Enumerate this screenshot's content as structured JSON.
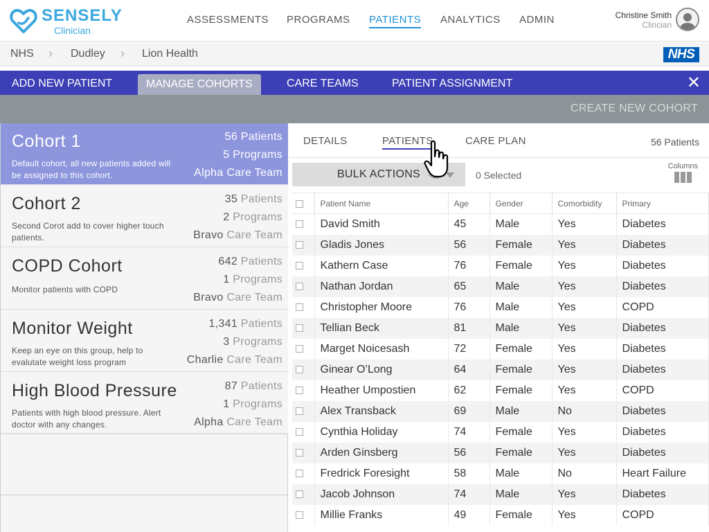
{
  "header": {
    "brand": "SENSELY",
    "brand_sub": "Clinician",
    "nav": [
      {
        "label": "ASSESSMENTS",
        "active": false
      },
      {
        "label": "PROGRAMS",
        "active": false
      },
      {
        "label": "PATIENTS",
        "active": true
      },
      {
        "label": "ANALYTICS",
        "active": false
      },
      {
        "label": "ADMIN",
        "active": false
      }
    ],
    "user_name": "Christine Smith",
    "user_role": "Clincian"
  },
  "breadcrumb": [
    "NHS",
    "Dudley",
    "Lion Health"
  ],
  "nhs_logo": "NHS",
  "tabs": [
    {
      "label": "ADD NEW PATIENT",
      "active": false
    },
    {
      "label": "MANAGE COHORTS",
      "active": true
    },
    {
      "label": "CARE TEAMS",
      "active": false
    },
    {
      "label": "PATIENT ASSIGNMENT",
      "active": false
    }
  ],
  "close_label": "✕",
  "create_label": "CREATE NEW COHORT",
  "cohorts": [
    {
      "title": "Cohort 1",
      "desc": "Default cohort, all new patients added will be assigned to this cohort.",
      "patients_num": "56",
      "patients_word": "Patients",
      "programs_num": "5",
      "programs_word": "Programs",
      "team_name": "Alpha",
      "team_word": "Care Team",
      "active": true
    },
    {
      "title": "Cohort 2",
      "desc": "Second Corot add to cover higher touch patients.",
      "patients_num": "35",
      "patients_word": "Patients",
      "programs_num": "2",
      "programs_word": "Programs",
      "team_name": "Bravo",
      "team_word": "Care Team",
      "active": false
    },
    {
      "title": "COPD Cohort",
      "desc": "Monitor patients with COPD",
      "patients_num": "642",
      "patients_word": "Patients",
      "programs_num": "1",
      "programs_word": "Programs",
      "team_name": "Bravo",
      "team_word": "Care Team",
      "active": false
    },
    {
      "title": "Monitor Weight",
      "desc": "Keep an eye on this group, help to evalutate weight loss program",
      "patients_num": "1,341",
      "patients_word": "Patients",
      "programs_num": "3",
      "programs_word": "Programs",
      "team_name": "Charlie",
      "team_word": "Care Team",
      "active": false
    },
    {
      "title": "High Blood Pressure",
      "desc": "Patients with high blood pressure.  Alert doctor with any changes.",
      "patients_num": "87",
      "patients_word": "Patients",
      "programs_num": "1",
      "programs_word": "Programs",
      "team_name": "Alpha",
      "team_word": "Care Team",
      "active": false
    }
  ],
  "detail": {
    "tabs": [
      {
        "label": "DETAILS",
        "active": false
      },
      {
        "label": "PATIENTS",
        "active": true
      },
      {
        "label": "CARE PLAN",
        "active": false
      }
    ],
    "patient_count": "56 Patients",
    "bulk_label": "BULK ACTIONS",
    "selected_label": "0 Selected",
    "columns_label": "Columns",
    "columns": [
      "Patient Name",
      "Age",
      "Gender",
      "Comorbidity",
      "Primary"
    ],
    "rows": [
      [
        "David Smith",
        "45",
        "Male",
        "Yes",
        "Diabetes"
      ],
      [
        "Gladis Jones",
        "56",
        "Female",
        "Yes",
        "Diabetes"
      ],
      [
        "Kathern Case",
        "76",
        "Female",
        "Yes",
        "Diabetes"
      ],
      [
        "Nathan Jordan",
        "65",
        "Male",
        "Yes",
        "Diabetes"
      ],
      [
        "Christopher Moore",
        "76",
        "Male",
        "Yes",
        "COPD"
      ],
      [
        "Tellian Beck",
        "81",
        "Male",
        "Yes",
        "Diabetes"
      ],
      [
        "Marget Noicesash",
        "72",
        "Female",
        "Yes",
        "Diabetes"
      ],
      [
        "Ginear O’Long",
        "64",
        "Female",
        "Yes",
        "Diabetes"
      ],
      [
        "Heather Umpostien",
        "62",
        "Female",
        "Yes",
        "COPD"
      ],
      [
        "Alex Transback",
        "69",
        "Male",
        "No",
        "Diabetes"
      ],
      [
        "Cynthia Holiday",
        "74",
        "Female",
        "Yes",
        "Diabetes"
      ],
      [
        "Arden Ginsberg",
        "56",
        "Female",
        "Yes",
        "Diabetes"
      ],
      [
        "Fredrick Foresight",
        "58",
        "Male",
        "No",
        "Heart Failure"
      ],
      [
        "Jacob Johnson",
        "74",
        "Male",
        "Yes",
        "Diabetes"
      ],
      [
        "Millie Franks",
        "49",
        "Female",
        "Yes",
        "COPD"
      ]
    ]
  },
  "colors": {
    "accent": "#3c3fb5",
    "active_cohort": "#8d96dd",
    "brand": "#3aa7df",
    "nhs": "#005eb8"
  }
}
